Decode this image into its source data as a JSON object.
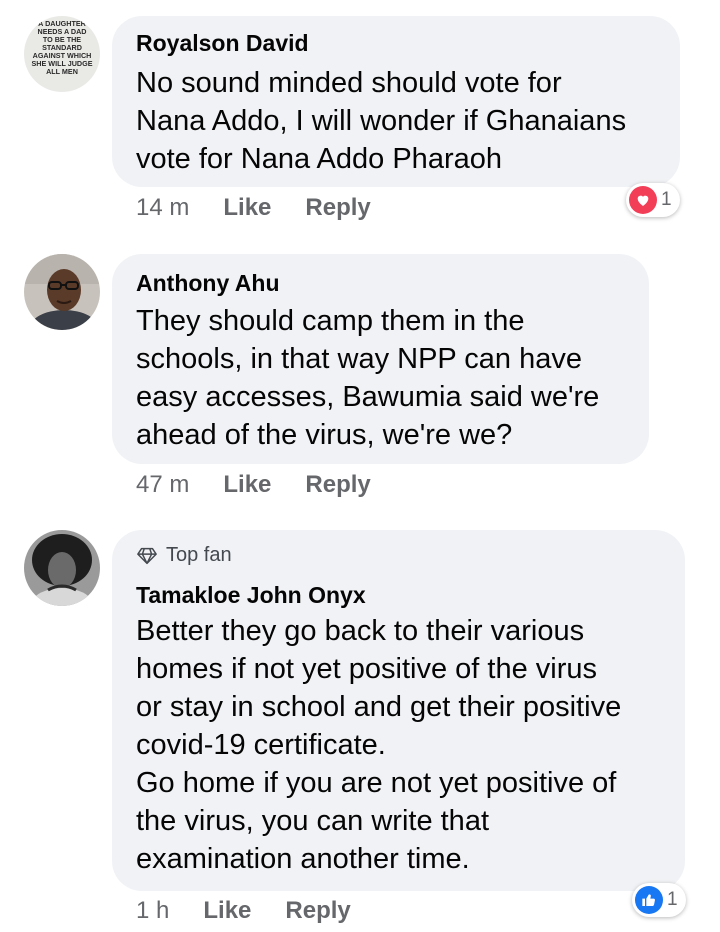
{
  "comments": [
    {
      "author": "Royalson David",
      "avatar_text": "A DAUGHTER NEEDS A DAD TO BE THE STANDARD AGAINST WHICH SHE WILL JUDGE ALL MEN",
      "lines": [
        "No sound minded should vote for",
        "Nana Addo, I will wonder if Ghanaians",
        "vote for Nana Addo Pharaoh"
      ],
      "time": "14 m",
      "like_label": "Like",
      "reply_label": "Reply",
      "reaction": {
        "icon": "heart-icon",
        "count": "1",
        "color": "#f33e58"
      }
    },
    {
      "author": "Anthony Ahu",
      "lines": [
        "They should camp them in the",
        "schools, in that way NPP can have",
        "easy accesses, Bawumia said we're",
        "ahead of the virus, we're we?"
      ],
      "time": "47 m",
      "like_label": "Like",
      "reply_label": "Reply"
    },
    {
      "badge": "Top fan",
      "badge_icon": "diamond-icon",
      "author": "Tamakloe John Onyx",
      "lines": [
        "Better they go back to their various",
        "homes if not yet positive of the virus",
        "or stay in school and get their positive",
        "covid-19 certificate.",
        "Go home if you are not yet positive of",
        "the virus, you can write that",
        "examination another time."
      ],
      "time": "1 h",
      "like_label": "Like",
      "reply_label": "Reply",
      "reaction": {
        "icon": "thumbs-up-icon",
        "count": "1",
        "color": "#1877f2"
      }
    }
  ]
}
